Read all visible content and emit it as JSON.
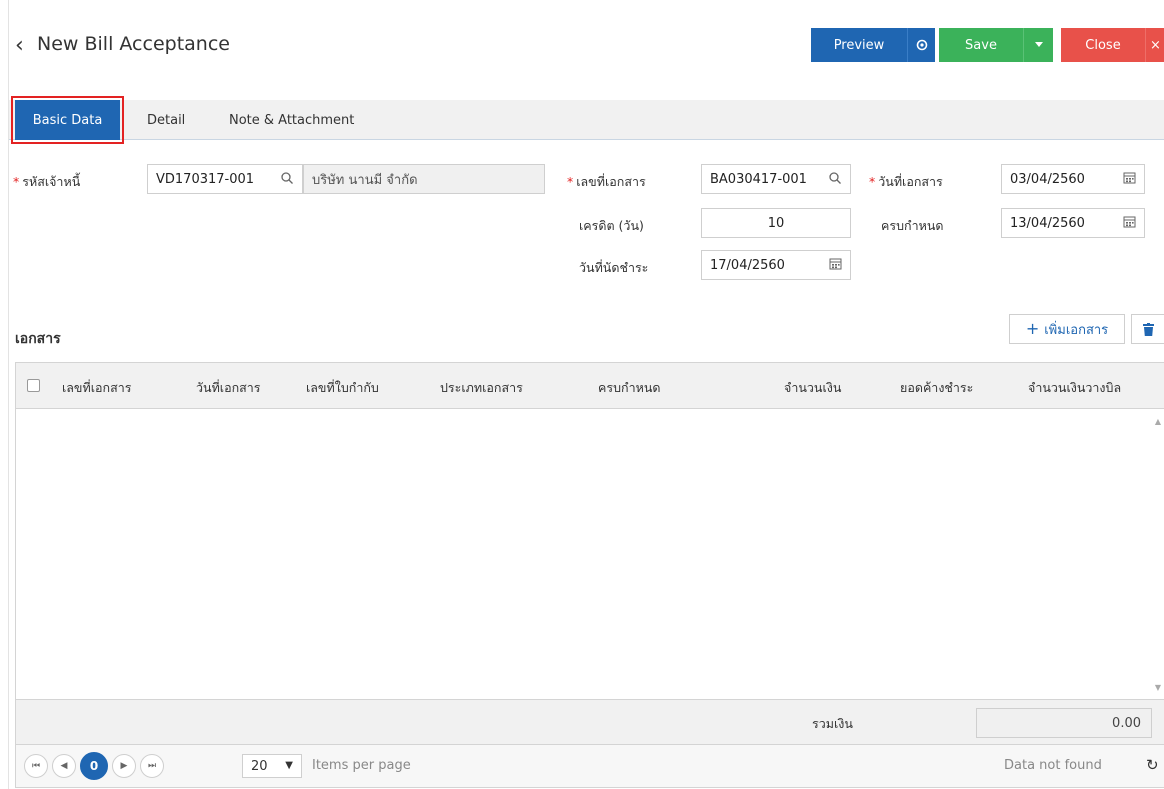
{
  "header": {
    "title": "New Bill Acceptance",
    "preview_label": "Preview",
    "save_label": "Save",
    "close_label": "Close"
  },
  "tabs": [
    {
      "label": "Basic Data",
      "active": true
    },
    {
      "label": "Detail",
      "active": false
    },
    {
      "label": "Note & Attachment",
      "active": false
    }
  ],
  "form": {
    "creditor_code_label": "รหัสเจ้าหนี้",
    "creditor_code_value": "VD170317-001",
    "creditor_name_value": "บริษัท นานมี จำกัด",
    "doc_no_label": "เลขที่เอกสาร",
    "doc_no_value": "BA030417-001",
    "doc_date_label": "วันที่เอกสาร",
    "doc_date_value": "03/04/2560",
    "credit_days_label": "เครดิต (วัน)",
    "credit_days_value": "10",
    "due_label": "ครบกำหนด",
    "due_value": "13/04/2560",
    "payment_date_label": "วันที่นัดชำระ",
    "payment_date_value": "17/04/2560"
  },
  "documents": {
    "section_title": "เอกสาร",
    "add_button_label": "เพิ่มเอกสาร",
    "columns": [
      "เลขที่เอกสาร",
      "วันที่เอกสาร",
      "เลขที่ใบกำกับ",
      "ประเภทเอกสาร",
      "ครบกำหนด",
      "จำนวนเงิน",
      "ยอดค้างชำระ",
      "จำนวนเงินวางบิล"
    ],
    "rows": [],
    "total_label": "รวมเงิน",
    "total_value": "0.00"
  },
  "pager": {
    "current_page": "0",
    "page_size": "20",
    "items_per_page_label": "Items per page",
    "status": "Data not found"
  },
  "colors": {
    "primary": "#1f66b2",
    "success": "#3bb25a",
    "danger": "#e8514a",
    "highlight": "#e32222"
  }
}
